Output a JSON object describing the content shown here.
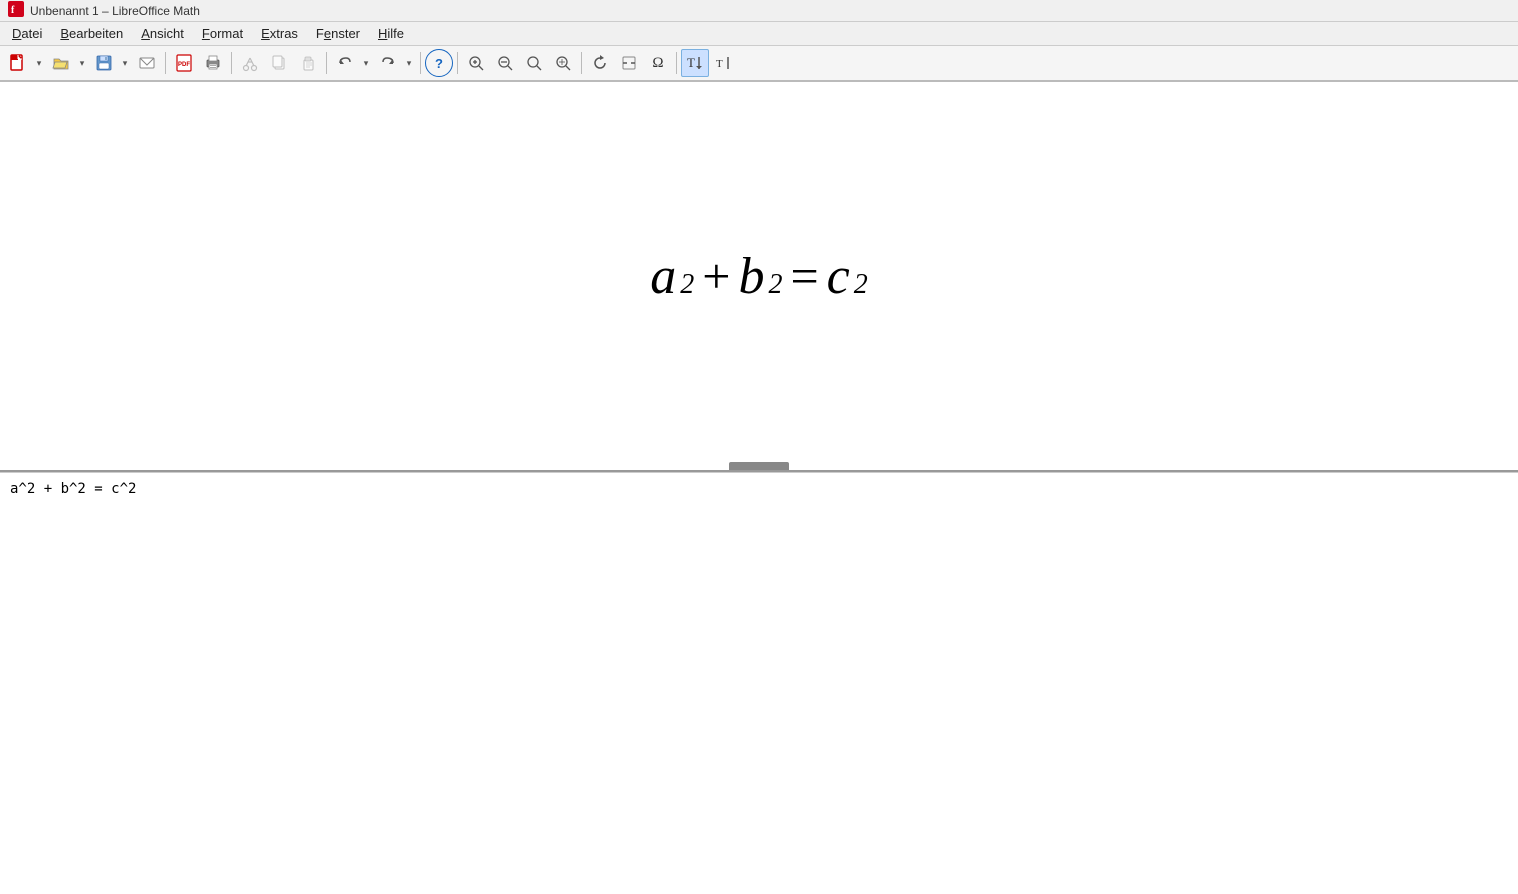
{
  "title_bar": {
    "title": "Unbenannt 1 – LibreOffice Math"
  },
  "menu": {
    "items": [
      {
        "label": "Datei",
        "underline_index": 0
      },
      {
        "label": "Bearbeiten",
        "underline_index": 0
      },
      {
        "label": "Ansicht",
        "underline_index": 0
      },
      {
        "label": "Format",
        "underline_index": 0
      },
      {
        "label": "Extras",
        "underline_index": 0
      },
      {
        "label": "Fenster",
        "underline_index": 0
      },
      {
        "label": "Hilfe",
        "underline_index": 0
      }
    ]
  },
  "toolbar": {
    "buttons": [
      {
        "name": "new-button",
        "icon": "📄",
        "tooltip": "Neu"
      },
      {
        "name": "open-button",
        "icon": "📂",
        "tooltip": "Öffnen"
      },
      {
        "name": "save-button",
        "icon": "💾",
        "tooltip": "Speichern"
      },
      {
        "name": "email-button",
        "icon": "✉",
        "tooltip": "E-Mail"
      },
      {
        "name": "pdf-button",
        "icon": "⬛",
        "tooltip": "PDF exportieren"
      },
      {
        "name": "print-button",
        "icon": "🖨",
        "tooltip": "Drucken"
      },
      {
        "name": "cut-button",
        "icon": "✂",
        "tooltip": "Ausschneiden"
      },
      {
        "name": "copy-button",
        "icon": "⧉",
        "tooltip": "Kopieren"
      },
      {
        "name": "paste-button",
        "icon": "📋",
        "tooltip": "Einfügen"
      },
      {
        "name": "undo-button",
        "icon": "↩",
        "tooltip": "Rückgängig"
      },
      {
        "name": "redo-button",
        "icon": "↪",
        "tooltip": "Wiederherstellen"
      },
      {
        "name": "help-button",
        "icon": "?",
        "tooltip": "Hilfe"
      },
      {
        "name": "zoom-in-button",
        "icon": "+🔍",
        "tooltip": "Vergrößern"
      },
      {
        "name": "zoom-out-button",
        "icon": "🔍-",
        "tooltip": "Verkleinern"
      },
      {
        "name": "zoom-100-button",
        "icon": "1:1",
        "tooltip": "Zoom 100%"
      },
      {
        "name": "zoom-optimal-button",
        "icon": "⊡",
        "tooltip": "Optimale Ansicht"
      },
      {
        "name": "update-button",
        "icon": "↻",
        "tooltip": "Aktualisieren"
      },
      {
        "name": "insert-special-button",
        "icon": "□",
        "tooltip": "Sonderzeichen"
      },
      {
        "name": "symbols-button",
        "icon": "Ω",
        "tooltip": "Symbole"
      },
      {
        "name": "format-text-button",
        "icon": "T↕",
        "tooltip": "Text formatieren",
        "active": true
      },
      {
        "name": "formula-cursor-button",
        "icon": "T|",
        "tooltip": "Formelcursor"
      }
    ]
  },
  "preview": {
    "formula_text": "a² + b² = c²",
    "formula_parts": [
      {
        "type": "var",
        "value": "a"
      },
      {
        "type": "sup",
        "value": "2"
      },
      {
        "type": "op",
        "value": "+"
      },
      {
        "type": "var",
        "value": "b"
      },
      {
        "type": "sup",
        "value": "2"
      },
      {
        "type": "op",
        "value": "="
      },
      {
        "type": "var",
        "value": "c"
      },
      {
        "type": "sup",
        "value": "2"
      }
    ]
  },
  "editor": {
    "content": "a^2  +  b^2  =  c^2"
  }
}
